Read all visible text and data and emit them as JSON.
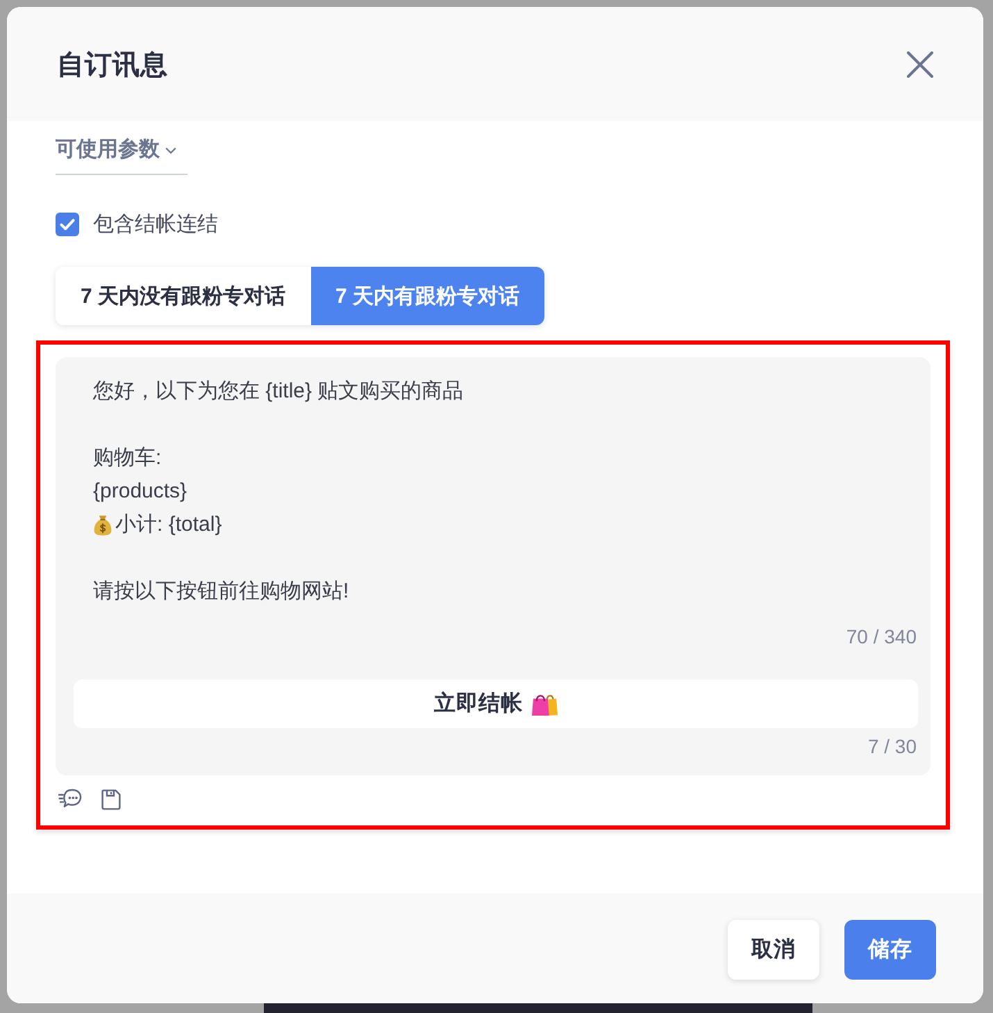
{
  "dialog": {
    "title": "自订讯息"
  },
  "params_dropdown": {
    "label": "可使用参数"
  },
  "checkout_link": {
    "label": "包含结帐连结",
    "checked": true
  },
  "tabs": [
    {
      "label": "7 天内没有跟粉专对话",
      "selected": false
    },
    {
      "label": "7 天内有跟粉专对话",
      "selected": true
    }
  ],
  "editor": {
    "highlighted": true,
    "paragraphs": [
      [
        {
          "kind": "plain",
          "text": "您好，以下为您在 {title} 贴文购买的商品"
        }
      ],
      [
        {
          "kind": "plain",
          "text": "购物车:"
        },
        {
          "kind": "plain",
          "text": "{products}"
        },
        {
          "kind": "money",
          "text": "小计: {total}"
        }
      ],
      [
        {
          "kind": "plain",
          "text": "请按以下按钮前往购物网站!"
        }
      ]
    ],
    "message_counter": "70 / 340",
    "button": {
      "label": "立即结帐"
    },
    "button_counter": "7 / 30"
  },
  "footer": {
    "buttons": [
      {
        "label": "取消",
        "kind": "secondary"
      },
      {
        "label": "储存",
        "kind": "primary"
      }
    ]
  }
}
